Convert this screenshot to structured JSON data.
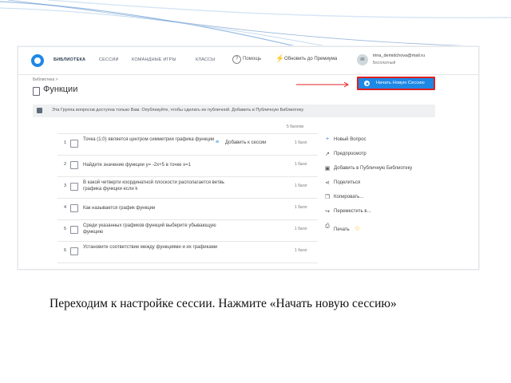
{
  "app": {
    "nav": [
      "БИБЛИОТЕКА",
      "СЕССИИ",
      "КОМАНДНЫЕ ИГРЫ",
      "КЛАССЫ"
    ],
    "help": "Помощь",
    "premium": "Обновить до Премиума",
    "avatar_initials": "IR",
    "user_email": "irina_demidchova@mail.ru",
    "user_account": "Бесплатный"
  },
  "breadcrumb": "Библиотека  >",
  "page_title": "Функции",
  "start_session_button": "Начать Новую Сессию",
  "info_bar": "Эта Группа вопросов доступна только Вам. Опубликуйте, чтобы сделать ее публичной. Добавить в Публичную Библиотеку",
  "questions_header": "5 баллов",
  "add_to_session": "Добавить к сессии",
  "questions": [
    {
      "num": "1",
      "text": "Точка (1;0) является центром симметрии графика функции",
      "score": "1 балл"
    },
    {
      "num": "2",
      "text": "Найдите значение функции у= -2x+5 в точке х=1",
      "score": "1 балл"
    },
    {
      "num": "3",
      "text": "В какой четверти координатной плоскости располагается ветвь графика функции если k",
      "score": "1 балл"
    },
    {
      "num": "4",
      "text": "Как называется график функции",
      "score": "1 балл"
    },
    {
      "num": "5",
      "text": "Среди указанных графиков функций выберите убывающую функцию",
      "score": "1 балл"
    },
    {
      "num": "6",
      "text": "Установите соответствие между функциями и их графиками",
      "score": "1 балл"
    }
  ],
  "actions": [
    {
      "icon": "plus-icon",
      "label": "Новый Вопрос"
    },
    {
      "icon": "preview-icon",
      "label": "Предпросмотр"
    },
    {
      "icon": "library-icon",
      "label": "Добавить в Публичную Библиотеку"
    },
    {
      "icon": "share-icon",
      "label": "Поделиться"
    },
    {
      "icon": "copy-icon",
      "label": "Копировать..."
    },
    {
      "icon": "move-icon",
      "label": "Переместить в..."
    },
    {
      "icon": "print-icon",
      "label": "Печать"
    }
  ],
  "caption": "Переходим к настройке сессии. Нажмите  «Начать новую сессию»",
  "colors": {
    "accent": "#1e88e5",
    "highlight": "#e02020",
    "star": "#f4c51a"
  }
}
